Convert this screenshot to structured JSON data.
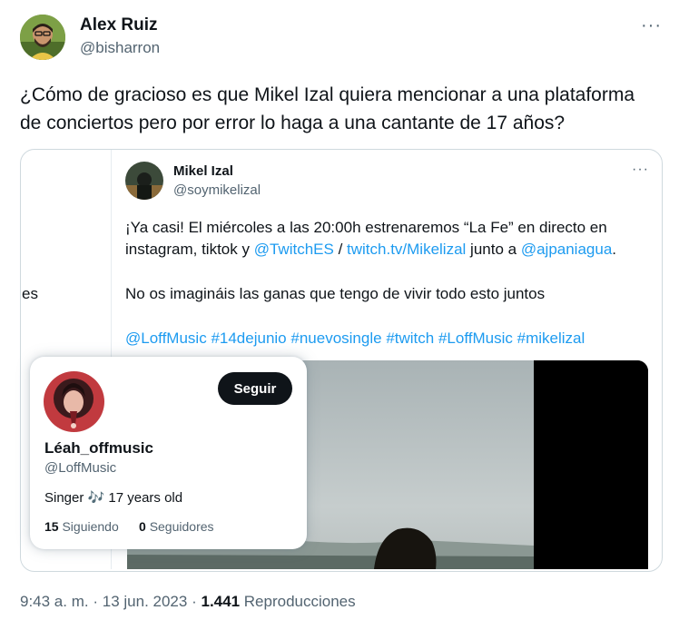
{
  "author": {
    "name": "Alex Ruiz",
    "handle": "@bisharron",
    "more": "···"
  },
  "tweet_text": "¿Cómo de gracioso es que Mikel Izal quiera mencionar a una plataforma de conciertos pero por error lo haga a una cantante de 17 años?",
  "left_fragment": "es",
  "quoted": {
    "name": "Mikel Izal",
    "handle": "@soymikelizal",
    "more": "···",
    "line1_a": "¡Ya casi! El miércoles a las 20:00h estrenaremos “La Fe” en directo en",
    "line2_a": "instagram, tiktok y ",
    "mention_twitch": "@TwitchES",
    "line2_sep": " / ",
    "link_twitch": "twitch.tv/Mikelizal",
    "line2_b": " junto a ",
    "mention_aj": "@ajpaniagua",
    "line2_end": ".",
    "line3": "No os imagináis las ganas que tengo de vivir todo esto juntos",
    "tags": [
      "@LoffMusic",
      "#14dejunio",
      "#nuevosingle",
      "#twitch",
      "#LoffMusic",
      "#mikelizal"
    ]
  },
  "hover_card": {
    "name": "Léah_offmusic",
    "handle": "@LoffMusic",
    "follow_label": "Seguir",
    "bio_a": "Singer",
    "bio_icon": "🎶",
    "bio_b": "17 years old",
    "following_count": "15",
    "following_label": "Siguiendo",
    "followers_count": "0",
    "followers_label": "Seguidores"
  },
  "footer": {
    "time": "9:43 a. m.",
    "sep1": "·",
    "date": "13 jun. 2023",
    "sep2": "·",
    "views_count": "1.441",
    "views_label": "Reproducciones"
  },
  "colors": {
    "link": "#1d9bf0",
    "text": "#0f1419",
    "muted": "#536471",
    "border": "#cfd9de"
  }
}
